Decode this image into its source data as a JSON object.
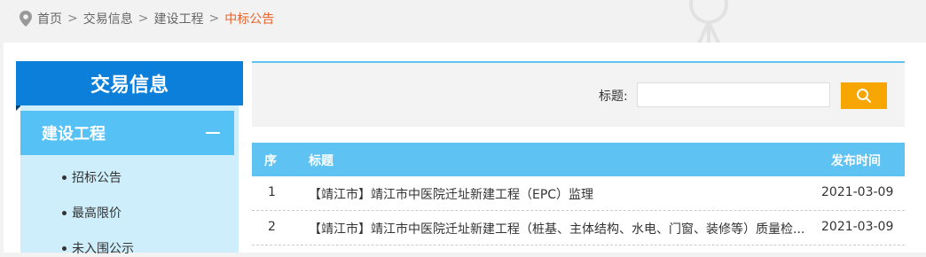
{
  "breadcrumb": {
    "items": [
      "首页",
      "交易信息",
      "建设工程"
    ],
    "current": "中标公告",
    "separator": ">"
  },
  "sidebar": {
    "title": "交易信息",
    "category": "建设工程",
    "items": [
      "招标公告",
      "最高限价",
      "未入围公示"
    ]
  },
  "search": {
    "label": "标题:",
    "value": "",
    "placeholder": ""
  },
  "table": {
    "headers": {
      "index": "序",
      "title": "标题",
      "date": "发布时间"
    },
    "rows": [
      {
        "index": "1",
        "title": "【靖江市】靖江市中医院迁址新建工程（EPC）监理",
        "date": "2021-03-09"
      },
      {
        "index": "2",
        "title": "【靖江市】靖江市中医院迁址新建工程（桩基、主体结构、水电、门窗、装修等）质量检...",
        "date": "2021-03-09"
      }
    ]
  },
  "colors": {
    "accent": "#0b7fd9",
    "light_blue": "#5ec2f2",
    "search_button": "#f7a500",
    "breadcrumb_current": "#e8632b"
  },
  "icons": {
    "location": "map-pin-icon",
    "search": "search-icon",
    "collapse": "minus-icon"
  }
}
